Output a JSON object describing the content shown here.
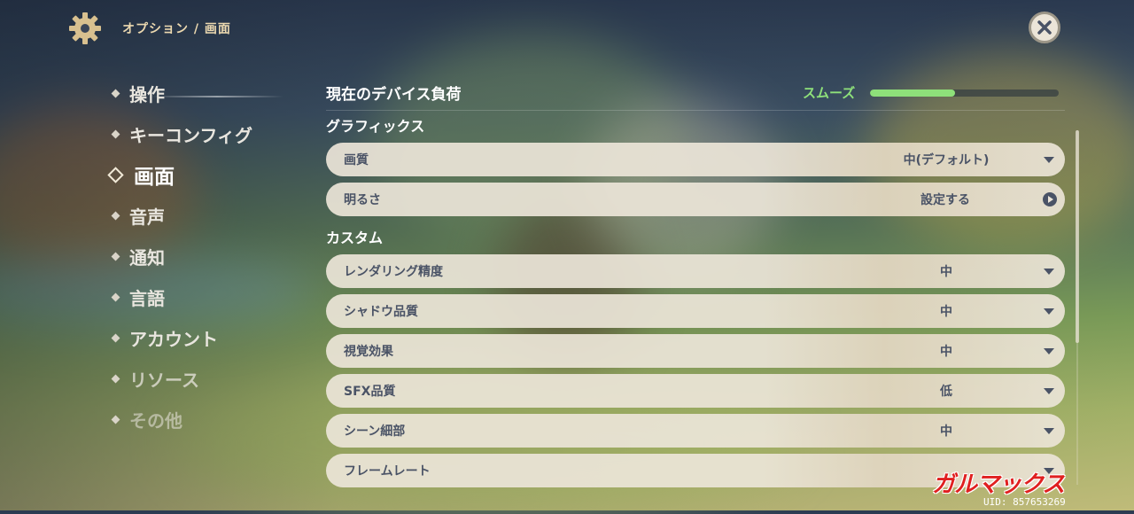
{
  "header": {
    "breadcrumb": "オプション / 画面"
  },
  "nav": {
    "items": [
      {
        "label": "操作"
      },
      {
        "label": "キーコンフィグ"
      },
      {
        "label": "画面"
      },
      {
        "label": "音声"
      },
      {
        "label": "通知"
      },
      {
        "label": "言語"
      },
      {
        "label": "アカウント"
      },
      {
        "label": "リソース"
      },
      {
        "label": "その他"
      }
    ],
    "active": "画面"
  },
  "device_load": {
    "title": "現在のデバイス負荷",
    "status": "スムーズ",
    "level_fraction": 0.45,
    "color": "#8ee07a"
  },
  "graphics": {
    "title": "グラフィックス",
    "rows": [
      {
        "label": "画質",
        "value": "中(デフォルト)",
        "control": "dropdown"
      },
      {
        "label": "明るさ",
        "value": "設定する",
        "control": "action"
      }
    ]
  },
  "custom": {
    "title": "カスタム",
    "rows": [
      {
        "label": "レンダリング精度",
        "value": "中",
        "control": "dropdown"
      },
      {
        "label": "シャドウ品質",
        "value": "中",
        "control": "dropdown"
      },
      {
        "label": "視覚効果",
        "value": "中",
        "control": "dropdown"
      },
      {
        "label": "SFX品質",
        "value": "低",
        "control": "dropdown"
      },
      {
        "label": "シーン細部",
        "value": "中",
        "control": "dropdown"
      },
      {
        "label": "フレームレート",
        "value": "",
        "control": "dropdown"
      }
    ]
  },
  "watermark": {
    "text": "ガルマックス"
  },
  "uid": "UID: 857653269",
  "colors": {
    "accent_text": "#ecd9b0",
    "row_bg": "#ece5d8",
    "row_text": "#4a5366"
  },
  "icons": {
    "settings": "gear-icon",
    "close": "close-icon"
  }
}
